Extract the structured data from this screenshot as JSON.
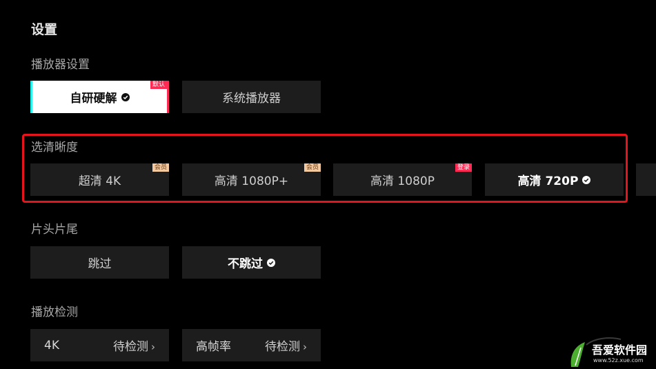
{
  "page_title": "设置",
  "player": {
    "title": "播放器设置",
    "options": [
      {
        "label": "自研硬解",
        "badge": "默认"
      },
      {
        "label": "系统播放器"
      }
    ]
  },
  "resolution": {
    "title": "选清晰度",
    "options": [
      {
        "label": "超清 4K",
        "badge": "会员"
      },
      {
        "label": "高清 1080P+",
        "badge": "会员"
      },
      {
        "label": "高清 1080P",
        "badge": "登录"
      },
      {
        "label": "高清 720P"
      }
    ]
  },
  "skip": {
    "title": "片头片尾",
    "options": [
      {
        "label": "跳过"
      },
      {
        "label": "不跳过"
      }
    ]
  },
  "detect": {
    "title": "播放检测",
    "items": [
      {
        "label": "4K",
        "status": "待检测"
      },
      {
        "label": "高帧率",
        "status": "待检测"
      }
    ]
  },
  "watermark": {
    "text": "吾爱软件园",
    "url": "www.52z.xue.com"
  },
  "colors": {
    "highlight": "#e8141c",
    "accent_cyan": "#25f4ee",
    "accent_pink": "#fe2c55",
    "vip_badge": "#f3c9a0"
  }
}
